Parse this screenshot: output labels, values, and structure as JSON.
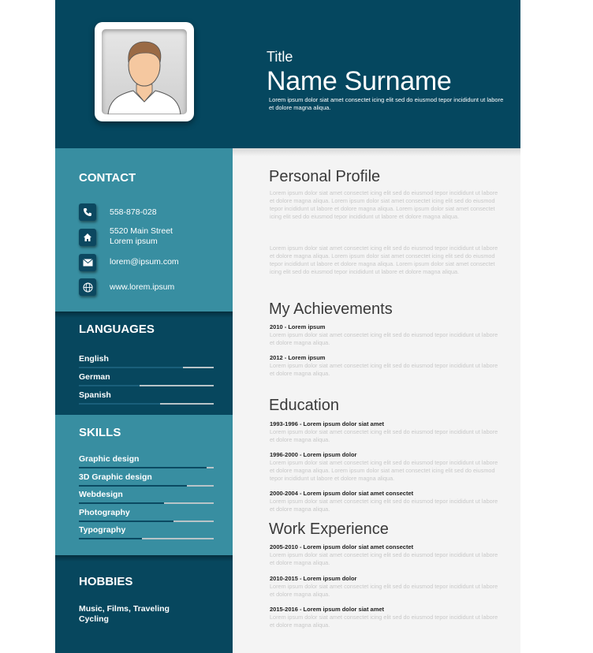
{
  "header": {
    "title": "Title",
    "name": "Name Surname",
    "description": "Lorem ipsum dolor siat amet consectet  icing elit sed do eiusmod tepor incididunt ut labore et dolore magna aliqua."
  },
  "contact": {
    "heading": "CONTACT",
    "items": [
      {
        "icon": "phone-icon",
        "text": "558-878-028"
      },
      {
        "icon": "home-icon",
        "text": "5520 Main Street\nLorem ipsum"
      },
      {
        "icon": "mail-icon",
        "text": "lorem@ipsum.com"
      },
      {
        "icon": "globe-icon",
        "text": "www.lorem.ipsum"
      }
    ]
  },
  "languages": {
    "heading": "LANGUAGES",
    "items": [
      {
        "label": "English",
        "level": 0.77
      },
      {
        "label": "German",
        "level": 0.45
      },
      {
        "label": "Spanish",
        "level": 0.6
      }
    ]
  },
  "skills": {
    "heading": "SKILLS",
    "items": [
      {
        "label": "Graphic design",
        "level": 0.95
      },
      {
        "label": "3D Graphic design",
        "level": 0.8
      },
      {
        "label": "Webdesign",
        "level": 0.63
      },
      {
        "label": "Photography",
        "level": 0.7
      },
      {
        "label": "Typography",
        "level": 0.47
      }
    ]
  },
  "hobbies": {
    "heading": "HOBBIES",
    "text": "Music, Films, Traveling\nCycling"
  },
  "profile": {
    "title": "Personal Profile",
    "paragraphs": [
      "Lorem ipsum dolor siat amet consectet  icing elit sed do eiusmod tepor incididunt ut labore et dolore magna aliqua. Lorem ipsum dolor siat amet consectet  icing elit sed do eiusmod tepor incididunt ut labore et dolore magna aliqua. Lorem ipsum dolor siat amet consectet  icing elit sed do eiusmod tepor incididunt ut labore et dolore magna aliqua.",
      "Lorem ipsum dolor siat amet consectet  icing elit sed do eiusmod tepor incididunt ut labore et dolore magna aliqua. Lorem ipsum dolor siat amet consectet  icing elit sed do eiusmod tepor incididunt ut labore et dolore magna aliqua. Lorem ipsum dolor siat amet consectet  icing elit sed do eiusmod tepor incididunt ut labore et dolore magna aliqua."
    ]
  },
  "achievements": {
    "title": "My Achievements",
    "entries": [
      {
        "head": "2010 - Lorem ipsum",
        "body": "Lorem ipsum dolor siat amet consectet  icing elit sed do eiusmod tepor incididunt ut labore et dolore magna aliqua."
      },
      {
        "head": "2012 - Lorem ipsum",
        "body": "Lorem ipsum dolor siat amet consectet  icing elit sed do eiusmod tepor incididunt ut labore et dolore magna aliqua."
      }
    ]
  },
  "education": {
    "title": "Education",
    "entries": [
      {
        "head": "1993-1996  -  Lorem ipsum dolor siat amet",
        "body": "Lorem ipsum dolor siat amet consectet  icing elit sed do eiusmod tepor incididunt ut labore et dolore magna aliqua."
      },
      {
        "head": "1996-2000  -  Lorem ipsum dolor",
        "body": "Lorem ipsum dolor siat amet consectet  icing elit sed do eiusmod tepor incididunt ut labore et dolore magna aliqua. Lorem ipsum dolor siat amet consectet  icing elit sed do eiusmod tepor incididunt ut labore et dolore magna aliqua."
      },
      {
        "head": "2000-2004  -  Lorem ipsum dolor siat amet consectet",
        "body": "Lorem ipsum dolor siat amet consectet  icing elit sed do eiusmod tepor incididunt ut labore et dolore magna aliqua."
      }
    ]
  },
  "experience": {
    "title": "Work Experience",
    "entries": [
      {
        "head": "2005-2010  -  Lorem ipsum dolor siat amet consectet",
        "body": "Lorem ipsum dolor siat amet consectet  icing elit sed do eiusmod tepor incididunt ut labore et dolore magna aliqua."
      },
      {
        "head": "2010-2015  -  Lorem ipsum dolor",
        "body": "Lorem ipsum dolor siat amet consectet  icing elit sed do eiusmod tepor incididunt ut labore et dolore magna aliqua."
      },
      {
        "head": "2015-2016  -  Lorem ipsum dolor siat amet",
        "body": "Lorem ipsum dolor siat amet consectet  icing elit sed do eiusmod tepor incididunt ut labore et dolore magna aliqua."
      }
    ]
  },
  "colors": {
    "dark_teal": "#05475f",
    "light_teal": "#388ea1",
    "main_bg": "#f4f4f4"
  }
}
